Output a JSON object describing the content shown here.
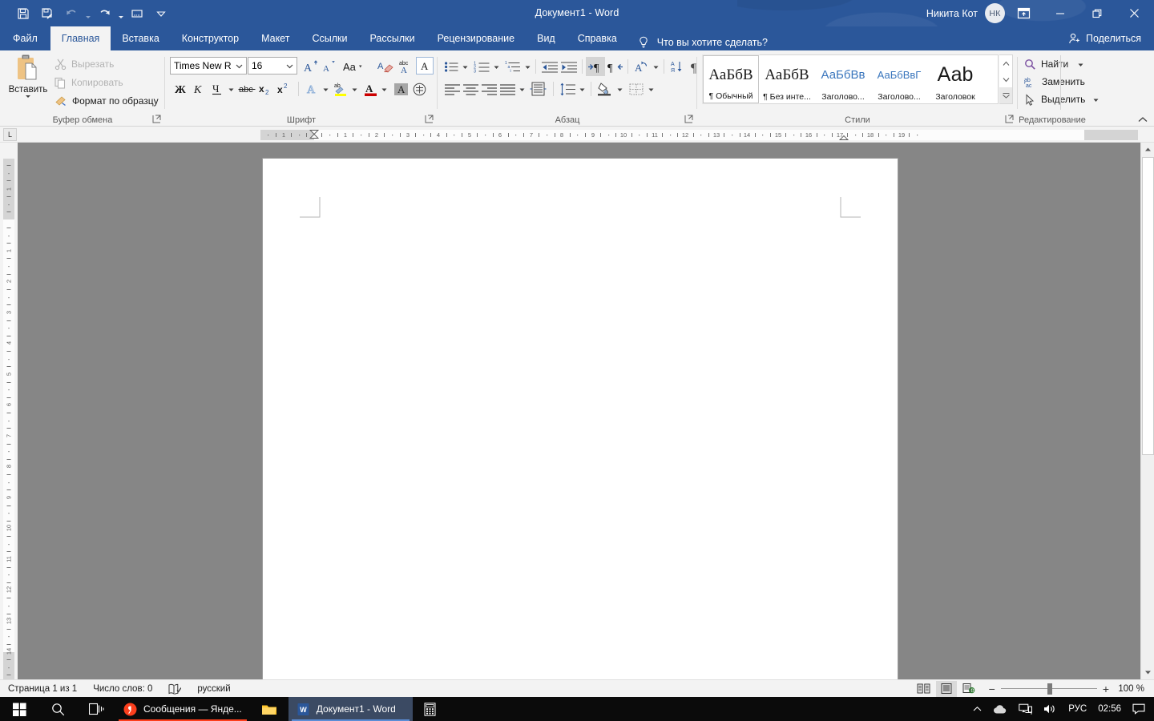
{
  "titlebar": {
    "document_title": "Документ1  -  Word",
    "user_name": "Никита Кот",
    "user_initials": "НК",
    "qat": [
      {
        "name": "save",
        "icon": "save-icon",
        "enabled": true
      },
      {
        "name": "save-as",
        "icon": "save-as-icon",
        "enabled": true
      },
      {
        "name": "undo",
        "icon": "undo-icon",
        "enabled": false
      },
      {
        "name": "redo",
        "icon": "redo-icon",
        "enabled": true
      },
      {
        "name": "touch-mode",
        "icon": "touch-mode-icon",
        "enabled": true
      },
      {
        "name": "customize-qat",
        "icon": "chevron-down-icon",
        "enabled": true
      }
    ],
    "window_buttons": {
      "ribbon_display": "ribbon-display-options-icon",
      "minimize": "minimize-icon",
      "restore": "restore-icon",
      "close": "close-icon"
    }
  },
  "tabs": {
    "items": [
      {
        "label": "Файл",
        "active": false
      },
      {
        "label": "Главная",
        "active": true
      },
      {
        "label": "Вставка",
        "active": false
      },
      {
        "label": "Конструктор",
        "active": false
      },
      {
        "label": "Макет",
        "active": false
      },
      {
        "label": "Ссылки",
        "active": false
      },
      {
        "label": "Рассылки",
        "active": false
      },
      {
        "label": "Рецензирование",
        "active": false
      },
      {
        "label": "Вид",
        "active": false
      },
      {
        "label": "Справка",
        "active": false
      }
    ],
    "tell_me": "Что вы хотите сделать?",
    "share_label": "Поделиться"
  },
  "ribbon": {
    "clipboard": {
      "group_label": "Буфер обмена",
      "paste_label": "Вставить",
      "cut_label": "Вырезать",
      "copy_label": "Копировать",
      "format_painter_label": "Формат по образцу"
    },
    "font": {
      "group_label": "Шрифт",
      "font_family_value": "Times New R",
      "font_size_value": "16",
      "buttons": [
        {
          "name": "grow-font",
          "label": "A"
        },
        {
          "name": "shrink-font",
          "label": "A"
        },
        {
          "name": "change-case",
          "label": "Aa"
        },
        {
          "name": "clear-formatting",
          "label": "clear"
        },
        {
          "name": "text-effects",
          "label": "abc"
        },
        {
          "name": "phonetic-guide",
          "label": "A"
        },
        {
          "name": "bold",
          "label": "Ж"
        },
        {
          "name": "italic",
          "label": "К"
        },
        {
          "name": "underline",
          "label": "Ч"
        },
        {
          "name": "strikethrough",
          "label": "abc"
        },
        {
          "name": "subscript",
          "label": "x₂"
        },
        {
          "name": "superscript",
          "label": "x²"
        },
        {
          "name": "text-effect-glow",
          "label": "A"
        },
        {
          "name": "text-highlight",
          "label": "ab"
        },
        {
          "name": "font-color",
          "label": "A"
        },
        {
          "name": "character-shading",
          "label": "A"
        },
        {
          "name": "enclose-characters",
          "label": "字"
        }
      ]
    },
    "paragraph": {
      "group_label": "Абзац",
      "buttons": [
        {
          "name": "bullets"
        },
        {
          "name": "numbering"
        },
        {
          "name": "multilevel-list"
        },
        {
          "name": "decrease-indent"
        },
        {
          "name": "increase-indent"
        },
        {
          "name": "ltr-text-direction"
        },
        {
          "name": "rtl-text-direction"
        },
        {
          "name": "asian-layout"
        },
        {
          "name": "sort"
        },
        {
          "name": "show-formatting-marks"
        },
        {
          "name": "align-left"
        },
        {
          "name": "align-center"
        },
        {
          "name": "align-right"
        },
        {
          "name": "justify"
        },
        {
          "name": "distributed"
        },
        {
          "name": "line-spacing"
        },
        {
          "name": "shading"
        },
        {
          "name": "borders"
        }
      ]
    },
    "styles": {
      "group_label": "Стили",
      "items": [
        {
          "preview": "АаБбВ",
          "name": "¶ Обычный",
          "selected": true,
          "style": "normal"
        },
        {
          "preview": "АаБбВ",
          "name": "¶ Без инте...",
          "selected": false,
          "style": "normal"
        },
        {
          "preview": "АаБбВв",
          "name": "Заголово...",
          "selected": false,
          "style": "heading1"
        },
        {
          "preview": "АаБбВвГ",
          "name": "Заголово...",
          "selected": false,
          "style": "heading2"
        },
        {
          "preview": "Ааb",
          "name": "Заголовок",
          "selected": false,
          "style": "title"
        }
      ]
    },
    "editing": {
      "group_label": "Редактирование",
      "find_label": "Найти",
      "replace_label": "Заменить",
      "select_label": "Выделить"
    },
    "collapse_icon": "chevron-up-icon"
  },
  "ruler": {
    "tab_stop_marker": "L",
    "horizontal_ticks": [
      1,
      1,
      2,
      3,
      4,
      5,
      6,
      7,
      8,
      9,
      10,
      11,
      12,
      13,
      14,
      15,
      16,
      17,
      18,
      19
    ],
    "vertical_ticks": [
      1,
      1,
      2,
      3,
      4,
      5,
      6,
      7,
      8,
      9,
      10,
      11,
      12,
      13,
      14
    ],
    "left_indent_position_cm": 0,
    "right_indent_position_cm": 17
  },
  "status_bar": {
    "page_info": "Страница 1 из 1",
    "word_count": "Число слов: 0",
    "proofing_icon": "proofing-icon",
    "language": "русский",
    "views": [
      {
        "name": "read-mode",
        "active": false
      },
      {
        "name": "print-layout",
        "active": true
      },
      {
        "name": "web-layout",
        "active": false
      }
    ],
    "zoom_out": "−",
    "zoom_in": "+",
    "zoom_value": "100 %",
    "zoom_percent": 100
  },
  "taskbar": {
    "start_icon": "windows-start-icon",
    "search_icon": "search-icon",
    "task_view_icon": "task-view-icon",
    "apps": [
      {
        "label": "Сообщения — Янде...",
        "icon": "yandex-icon",
        "active": false,
        "accent": "#fc3f1d"
      },
      {
        "label": "",
        "icon": "file-explorer-icon",
        "active": false,
        "accent": "#ffc62b"
      },
      {
        "label": "Документ1 - Word",
        "icon": "word-icon",
        "active": true,
        "accent": "#2b579a"
      },
      {
        "label": "",
        "icon": "calculator-icon",
        "active": false,
        "accent": "#888888"
      }
    ],
    "tray": {
      "overflow_icon": "chevron-up-icon",
      "onedrive_icon": "onedrive-icon",
      "network_icon": "network-icon",
      "volume_icon": "volume-icon",
      "language": "РУС",
      "clock": "02:56",
      "action_center_icon": "action-center-icon"
    }
  },
  "colors": {
    "brand": "#2b579a",
    "ribbon_bg": "#f3f3f3",
    "workspace_bg": "#868686",
    "page_bg": "#ffffff",
    "taskbar_bg": "#0b0b0b"
  }
}
